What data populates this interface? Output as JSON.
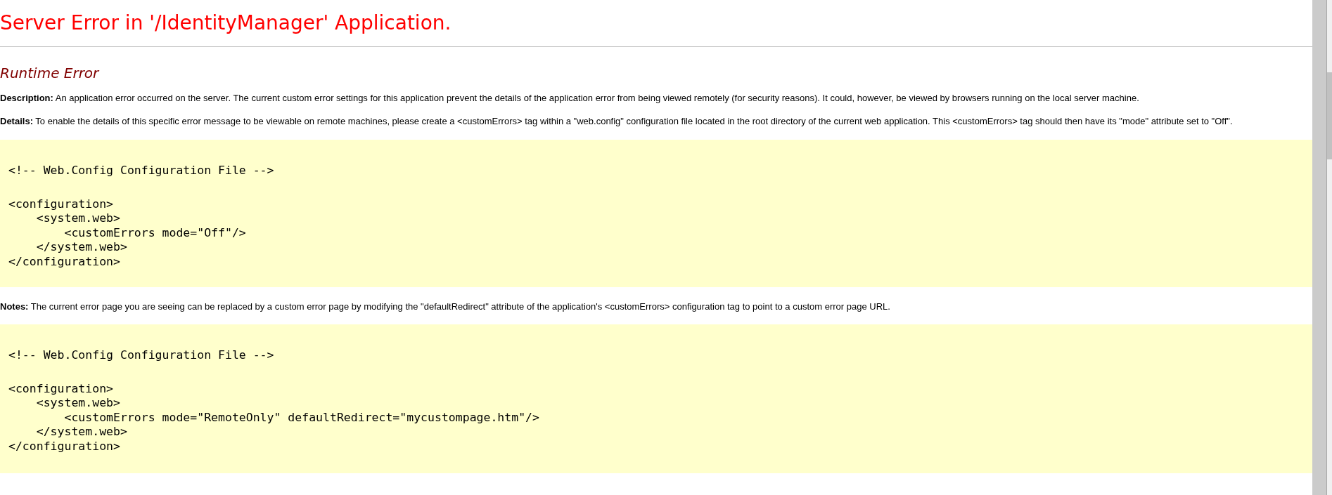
{
  "title": "Server Error in '/IdentityManager' Application.",
  "subtitle": "Runtime Error",
  "description": "**Description:** An application error occurred on the server. The current custom error settings for this application prevent the details of the application error from being viewed remotely (for security reasons). It could, however, be viewed by browsers running on the local server machine.",
  "details": "**Details:** To enable the details of this specific error message to be viewable on remote machines, please create a <customErrors> tag within a \"web.config\" configuration file located in the root directory of the current web application. This <customErrors> tag should then have its \"mode\" attribute set to \"Off\".",
  "code_block_1": {
    "comment": "<!-- Web.Config Configuration File -->",
    "lines": [
      "<configuration>",
      "    <system.web>",
      "        <customErrors mode=\"Off\"/>",
      "    </system.web>",
      "</configuration>"
    ]
  },
  "notes": "**Notes:** The current error page you are seeing can be replaced by a custom error page by modifying the \"defaultRedirect\" attribute of the application's <customErrors> configuration tag to point to a custom error page URL.",
  "code_block_2": {
    "comment": "<!-- Web.Config Configuration File -->",
    "lines": [
      "<configuration>",
      "    <system.web>",
      "        <customErrors mode=\"RemoteOnly\" defaultRedirect=\"mycustompage.htm\"/>",
      "    </system.web>",
      "</configuration>"
    ]
  }
}
